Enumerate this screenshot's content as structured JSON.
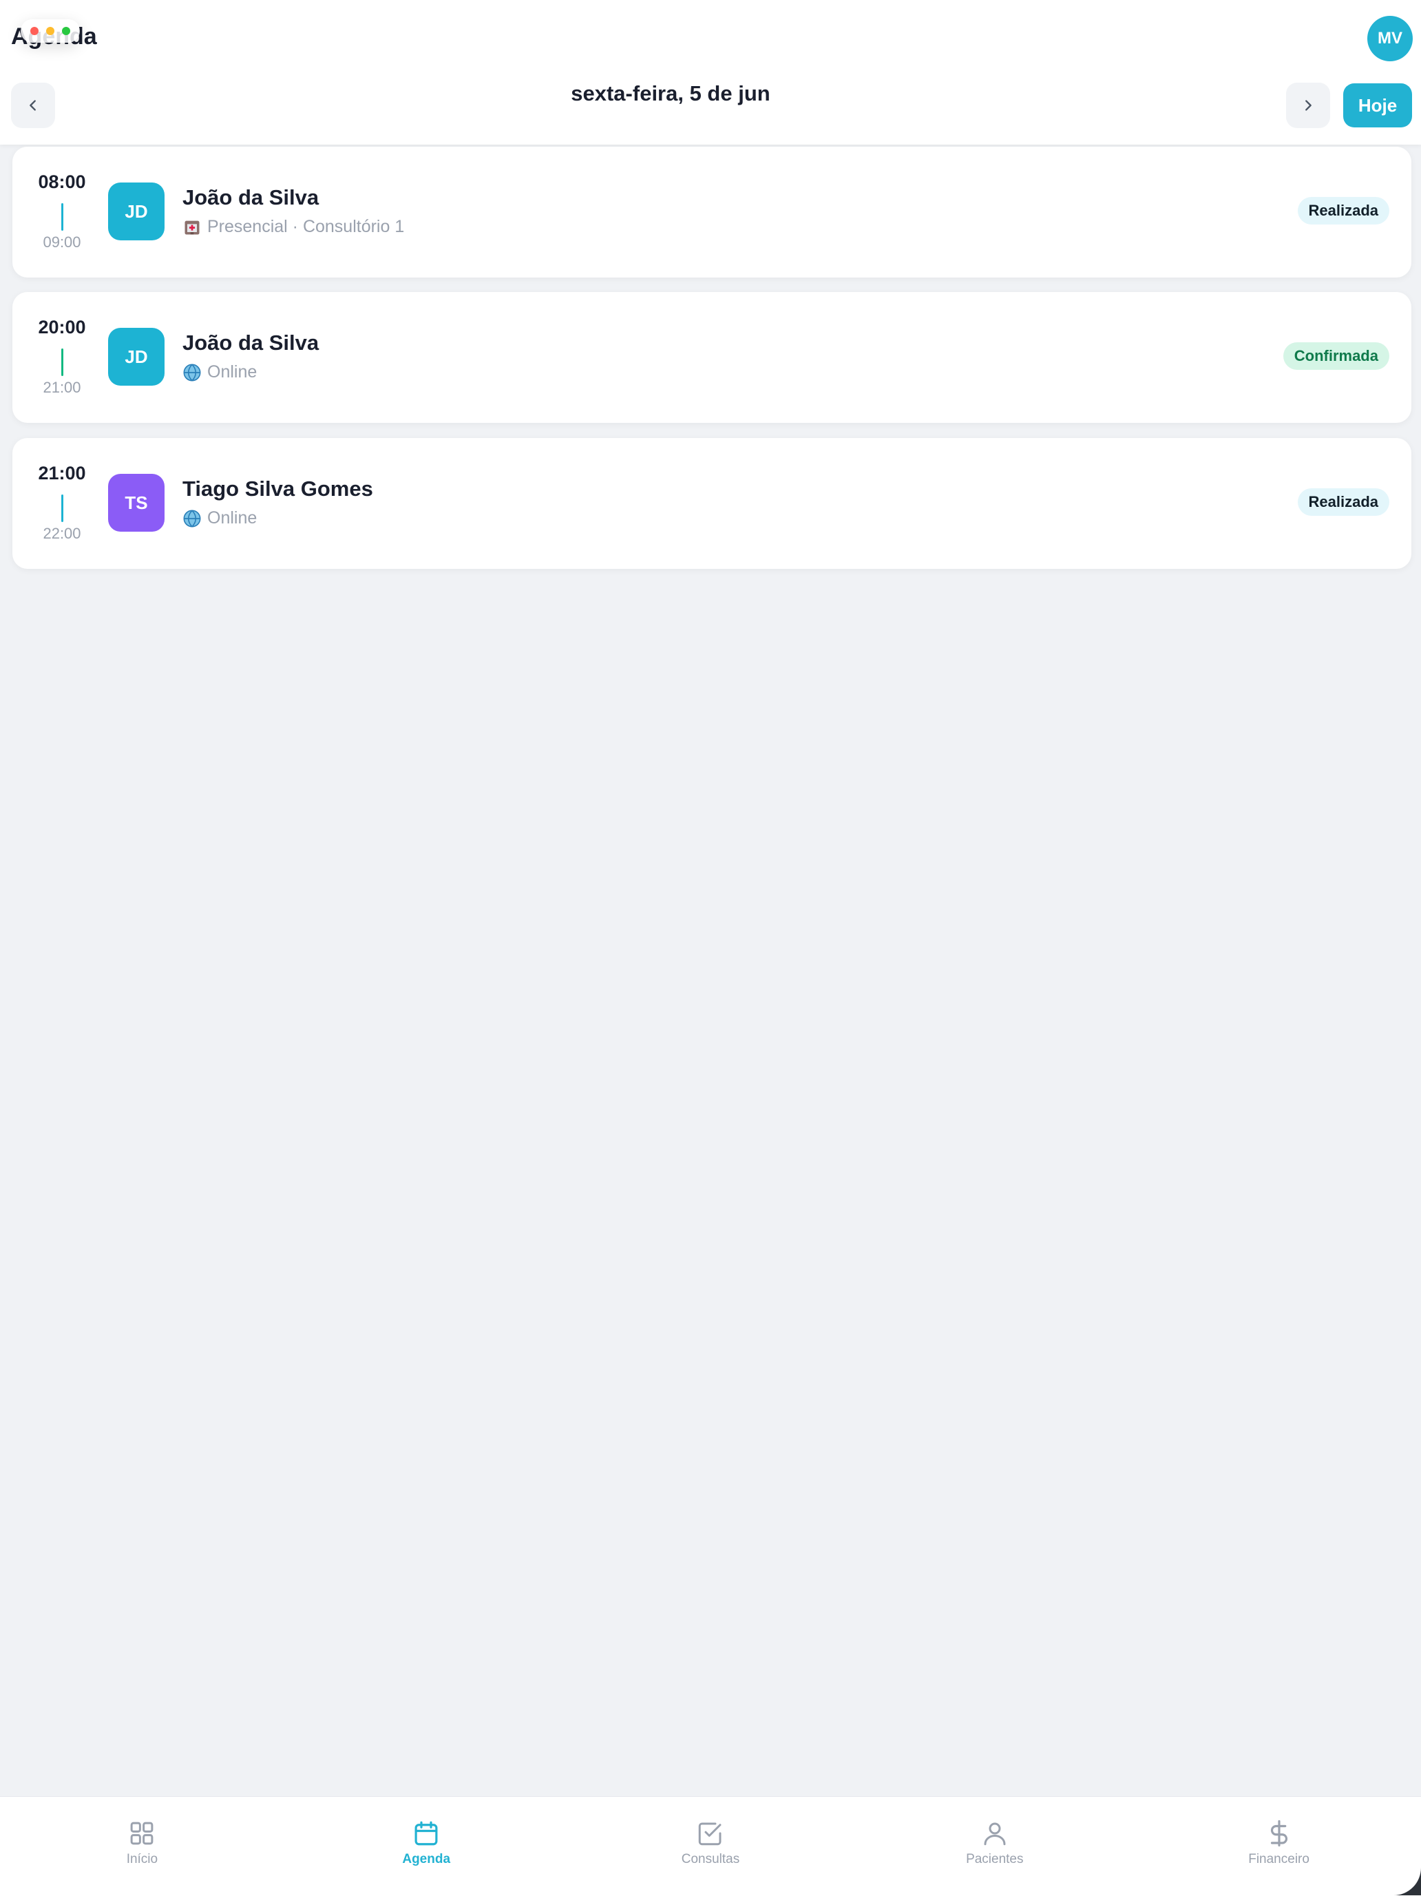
{
  "header": {
    "title": "Agenda",
    "user_initials": "MV",
    "date_label": "sexta-feira, 5 de jun",
    "today_label": "Hoje"
  },
  "appointments": [
    {
      "start": "08:00",
      "end": "09:00",
      "initials": "JD",
      "avatar_color": "#1db3d3",
      "line_color": "#1db3d3",
      "name": "João da Silva",
      "mode_icon": "hospital-icon",
      "mode": "Presencial · Consultório 1",
      "status": "Realizada",
      "status_bg": "#e3f6fb",
      "status_color": "#12202a"
    },
    {
      "start": "20:00",
      "end": "21:00",
      "initials": "JD",
      "avatar_color": "#1db3d3",
      "line_color": "#10b981",
      "name": "João da Silva",
      "mode_icon": "globe-icon",
      "mode": "Online",
      "status": "Confirmada",
      "status_bg": "#d5f5e6",
      "status_color": "#0f7a4b"
    },
    {
      "start": "21:00",
      "end": "22:00",
      "initials": "TS",
      "avatar_color": "#8b5cf6",
      "line_color": "#1db3d3",
      "name": "Tiago Silva Gomes",
      "mode_icon": "globe-icon",
      "mode": "Online",
      "status": "Realizada",
      "status_bg": "#e3f6fb",
      "status_color": "#12202a"
    }
  ],
  "tabbar": {
    "items": [
      {
        "label": "Início",
        "icon": "grid-icon",
        "active": false
      },
      {
        "label": "Agenda",
        "icon": "calendar-icon",
        "active": true
      },
      {
        "label": "Consultas",
        "icon": "checkbox-icon",
        "active": false
      },
      {
        "label": "Pacientes",
        "icon": "person-icon",
        "active": false
      },
      {
        "label": "Financeiro",
        "icon": "dollar-icon",
        "active": false
      }
    ]
  },
  "colors": {
    "accent": "#22b2d2",
    "background": "#f0f2f5",
    "text": "#1a1f2e",
    "muted": "#9aa1ad"
  }
}
